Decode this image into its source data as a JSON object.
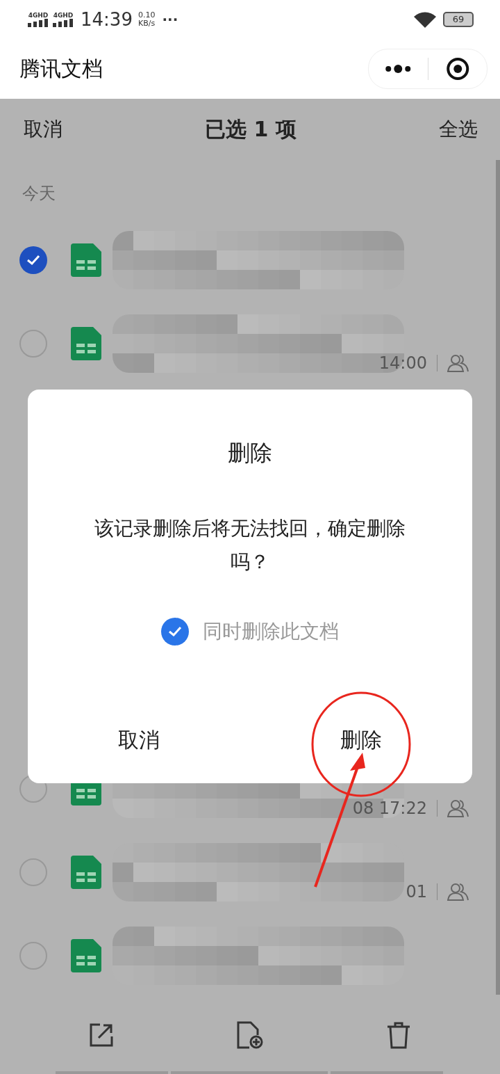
{
  "status_bar": {
    "networks": [
      "4GHD",
      "4GHD"
    ],
    "time": "14:39",
    "speed": "0.10",
    "speed_unit": "KB/s",
    "more": "···",
    "battery": "69"
  },
  "mini_program": {
    "title": "腾讯文档"
  },
  "selection_bar": {
    "cancel": "取消",
    "title": "已选 1 项",
    "select_all": "全选"
  },
  "section": {
    "label": "今天",
    "rows": [
      {
        "selected": true
      },
      {
        "selected": false,
        "time": "14:00",
        "shared": true
      }
    ]
  },
  "more_rows": [
    {
      "selected": false,
      "time": "08 17:22",
      "shared": true
    },
    {
      "selected": false,
      "time": "01",
      "shared": true
    },
    {
      "selected": false
    }
  ],
  "dialog": {
    "title": "删除",
    "message": "该记录删除后将无法找回，确定删除吗？",
    "checkbox": {
      "label": "同时删除此文档",
      "checked": true
    },
    "buttons": [
      {
        "label": "取消"
      },
      {
        "label": "删除"
      }
    ]
  }
}
